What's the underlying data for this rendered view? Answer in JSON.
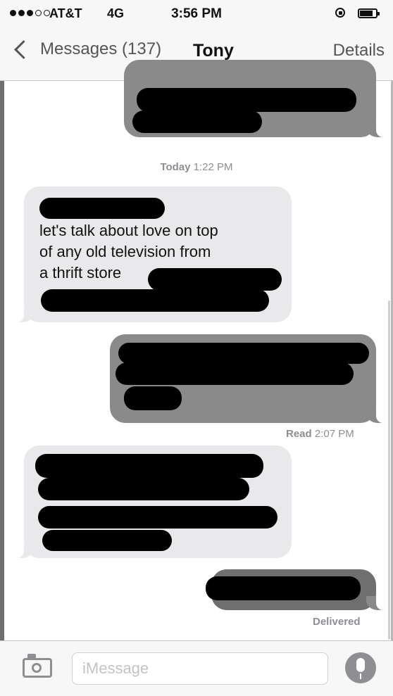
{
  "status_bar": {
    "carrier": "AT&T",
    "network": "4G",
    "time": "3:56 PM",
    "signal_bars_filled": 3,
    "signal_bars_total": 5
  },
  "nav": {
    "back_label": "Messages (137)",
    "contact_name": "Tony",
    "details_label": "Details"
  },
  "thread": {
    "timestamp_day": "Today",
    "timestamp_time": "1:22 PM",
    "received_1_text": "chapter 7 of\nlet's talk about love on top\nof any old television from\na thrift store",
    "read_label": "Read",
    "read_time": "2:07 PM",
    "delivered_label": "Delivered"
  },
  "input": {
    "placeholder": "iMessage"
  },
  "colors": {
    "incoming_bubble": "#e9e9ec",
    "outgoing_bubble": "#8a8a8a",
    "redaction": "#000000",
    "meta_text": "#8e8e93"
  }
}
